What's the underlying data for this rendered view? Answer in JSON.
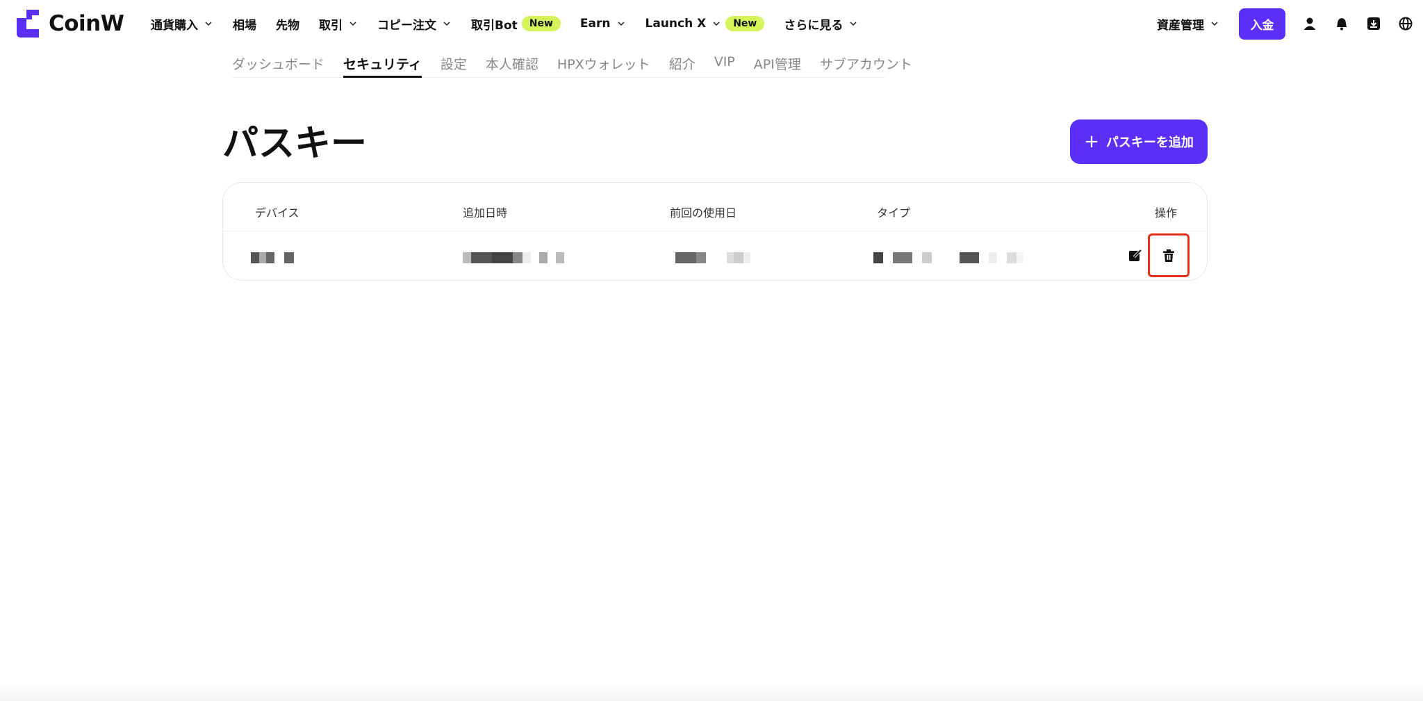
{
  "brand": {
    "name": "CoinW",
    "accent": "#5b2ff7",
    "badge_color": "#d4f45a",
    "highlight_color": "#e8301c"
  },
  "nav": {
    "items": [
      {
        "label": "通貨購入",
        "has_dropdown": true
      },
      {
        "label": "相場",
        "has_dropdown": false
      },
      {
        "label": "先物",
        "has_dropdown": false
      },
      {
        "label": "取引",
        "has_dropdown": true
      },
      {
        "label": "コピー注文",
        "has_dropdown": true
      },
      {
        "label": "取引Bot",
        "has_dropdown": false,
        "badge": "New"
      },
      {
        "label": "Earn",
        "has_dropdown": true
      },
      {
        "label": "Launch X",
        "has_dropdown": true,
        "badge": "New"
      },
      {
        "label": "さらに見る",
        "has_dropdown": true
      }
    ],
    "asset_management": "資産管理",
    "deposit_label": "入金",
    "icons": [
      "user-icon",
      "bell-icon",
      "download-icon",
      "globe-icon"
    ]
  },
  "subtabs": {
    "items": [
      "ダッシュボード",
      "セキュリティ",
      "設定",
      "本人確認",
      "HPXウォレット",
      "紹介",
      "VIP",
      "API管理",
      "サブアカウント"
    ],
    "active": "セキュリティ"
  },
  "page": {
    "title": "パスキー",
    "add_button": "パスキーを追加",
    "add_icon": "+"
  },
  "table": {
    "columns": [
      "デバイス",
      "追加日時",
      "前回の使用日",
      "タイプ",
      "操作"
    ],
    "rows": [
      {
        "device": "",
        "added": "",
        "last_used": "",
        "type": "",
        "actions": [
          "edit-icon",
          "trash-icon"
        ]
      }
    ]
  }
}
